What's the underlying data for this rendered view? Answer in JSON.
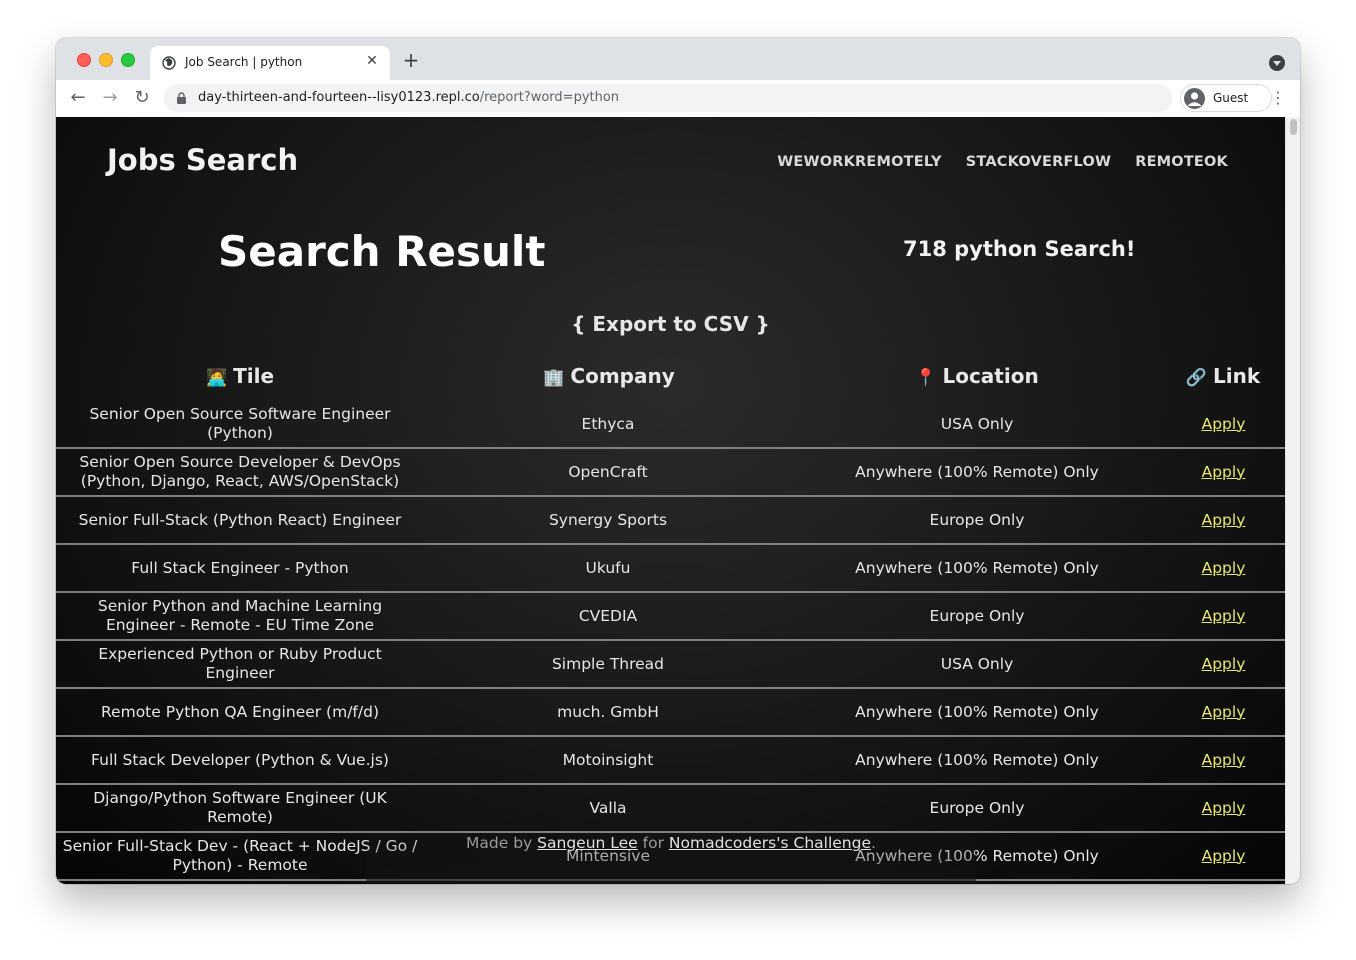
{
  "browser": {
    "tab_title": "Job Search | python",
    "url_host": "day-thirteen-and-fourteen--lisy0123.repl.co",
    "url_path": "/report?word=python",
    "profile_label": "Guest"
  },
  "header": {
    "brand": "Jobs Search",
    "nav": [
      "WEWORKREMOTELY",
      "STACKOVERFLOW",
      "REMOTEOK"
    ]
  },
  "main": {
    "heading": "Search Result",
    "count_text": "718 python Search!",
    "export_label": "{ Export to CSV }"
  },
  "table": {
    "headers": [
      {
        "icon": "🧑‍💻",
        "label": "Tile"
      },
      {
        "icon": "🏢",
        "label": "Company"
      },
      {
        "icon": "📍",
        "label": "Location"
      },
      {
        "icon": "🔗",
        "label": "Link"
      }
    ],
    "rows": [
      {
        "title": "Senior Open Source Software Engineer (Python)",
        "company": "Ethyca",
        "location": "USA Only",
        "link": "Apply"
      },
      {
        "title": "Senior Open Source Developer & DevOps (Python, Django, React, AWS/OpenStack)",
        "company": "OpenCraft",
        "location": "Anywhere (100% Remote) Only",
        "link": "Apply"
      },
      {
        "title": "Senior Full-Stack (Python React) Engineer",
        "company": "Synergy Sports",
        "location": "Europe Only",
        "link": "Apply"
      },
      {
        "title": "Full Stack Engineer - Python",
        "company": "Ukufu",
        "location": "Anywhere (100% Remote) Only",
        "link": "Apply"
      },
      {
        "title": "Senior Python and Machine Learning Engineer - Remote - EU Time Zone",
        "company": "CVEDIA",
        "location": "Europe Only",
        "link": "Apply"
      },
      {
        "title": "Experienced Python or Ruby Product Engineer",
        "company": "Simple Thread",
        "location": "USA Only",
        "link": "Apply"
      },
      {
        "title": "Remote Python QA Engineer (m/f/d)",
        "company": "much. GmbH",
        "location": "Anywhere (100% Remote) Only",
        "link": "Apply"
      },
      {
        "title": "Full Stack Developer (Python & Vue.js)",
        "company": "Motoinsight",
        "location": "Anywhere (100% Remote) Only",
        "link": "Apply"
      },
      {
        "title": "Django/Python Software Engineer (UK Remote)",
        "company": "Valla",
        "location": "Europe Only",
        "link": "Apply"
      },
      {
        "title": "Senior Full-Stack Dev - (React + NodeJS / Go / Python) - Remote",
        "company": "Mintensive",
        "location": "Anywhere (100% Remote) Only",
        "link": "Apply"
      }
    ]
  },
  "footer": {
    "prefix": "Made by ",
    "author": "Sangeun Lee",
    "middle": " for ",
    "challenge": "Nomadcoders's Challenge",
    "suffix": "."
  }
}
